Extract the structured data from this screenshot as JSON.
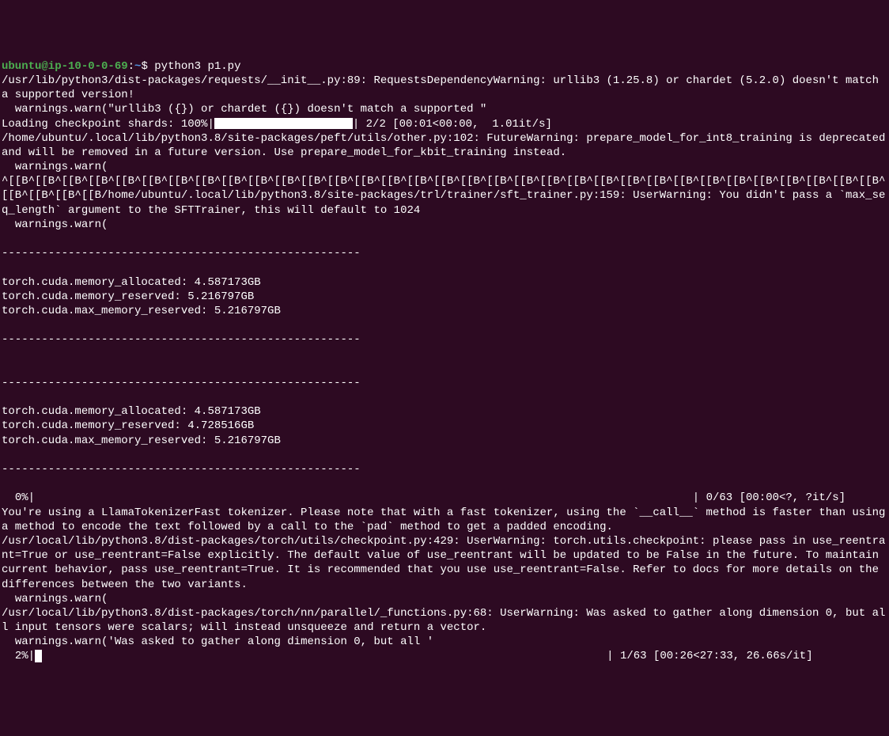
{
  "prompt": {
    "user": "ubuntu@ip-10-0-0-69",
    "separator": ":",
    "path": "~",
    "symbol": "$",
    "command": "python3 p1.py"
  },
  "lines": {
    "l1": "/usr/lib/python3/dist-packages/requests/__init__.py:89: RequestsDependencyWarning: urllib3 (1.25.8) or chardet (5.2.0) doesn't match a supported version!",
    "l2": "  warnings.warn(\"urllib3 ({}) or chardet ({}) doesn't match a supported \"",
    "l3a": "Loading checkpoint shards: 100%|",
    "l3b": "| 2/2 [00:01<00:00,  1.01it/s]",
    "l4": "/home/ubuntu/.local/lib/python3.8/site-packages/peft/utils/other.py:102: FutureWarning: prepare_model_for_int8_training is deprecated and will be removed in a future version. Use prepare_model_for_kbit_training instead.",
    "l5": "  warnings.warn(",
    "l6": "^[[B^[[B^[[B^[[B^[[B^[[B^[[B^[[B^[[B^[[B^[[B^[[B^[[B^[[B^[[B^[[B^[[B^[[B^[[B^[[B^[[B^[[B^[[B^[[B^[[B^[[B^[[B^[[B^[[B^[[B^[[B^[[B^[[B^[[B^[[B^[[B^[[B/home/ubuntu/.local/lib/python3.8/site-packages/trl/trainer/sft_trainer.py:159: UserWarning: You didn't pass a `max_seq_length` argument to the SFTTrainer, this will default to 1024",
    "l7": "  warnings.warn(",
    "l8": "",
    "dash": "------------------------------------------------------",
    "l10": "",
    "mem1a": "torch.cuda.memory_allocated: 4.587173GB",
    "mem1b": "torch.cuda.memory_reserved: 5.216797GB",
    "mem1c": "torch.cuda.max_memory_reserved: 5.216797GB",
    "l14": "",
    "l16": "",
    "l17": "",
    "l19": "",
    "mem2a": "torch.cuda.memory_allocated: 4.587173GB",
    "mem2b": "torch.cuda.memory_reserved: 4.728516GB",
    "mem2c": "torch.cuda.max_memory_reserved: 5.216797GB",
    "l23": "",
    "l25": "",
    "prog0a": "  0%|",
    "prog0b": "                                                                                                   ",
    "prog0c": "| 0/63 [00:00<?, ?it/s]",
    "l27": "You're using a LlamaTokenizerFast tokenizer. Please note that with a fast tokenizer, using the `__call__` method is faster than using a method to encode the text followed by a call to the `pad` method to get a padded encoding.",
    "l28": "/usr/local/lib/python3.8/dist-packages/torch/utils/checkpoint.py:429: UserWarning: torch.utils.checkpoint: please pass in use_reentrant=True or use_reentrant=False explicitly. The default value of use_reentrant will be updated to be False in the future. To maintain current behavior, pass use_reentrant=True. It is recommended that you use use_reentrant=False. Refer to docs for more details on the differences between the two variants.",
    "l29": "  warnings.warn(",
    "l30": "/usr/local/lib/python3.8/dist-packages/torch/nn/parallel/_functions.py:68: UserWarning: Was asked to gather along dimension 0, but all input tensors were scalars; will instead unsqueeze and return a vector.",
    "l31": "  warnings.warn('Was asked to gather along dimension 0, but all '",
    "prog2a": "  2%|",
    "prog2b": "                                                                                     ",
    "prog2c": "| 1/63 [00:26<27:33, 26.66s/it]"
  }
}
